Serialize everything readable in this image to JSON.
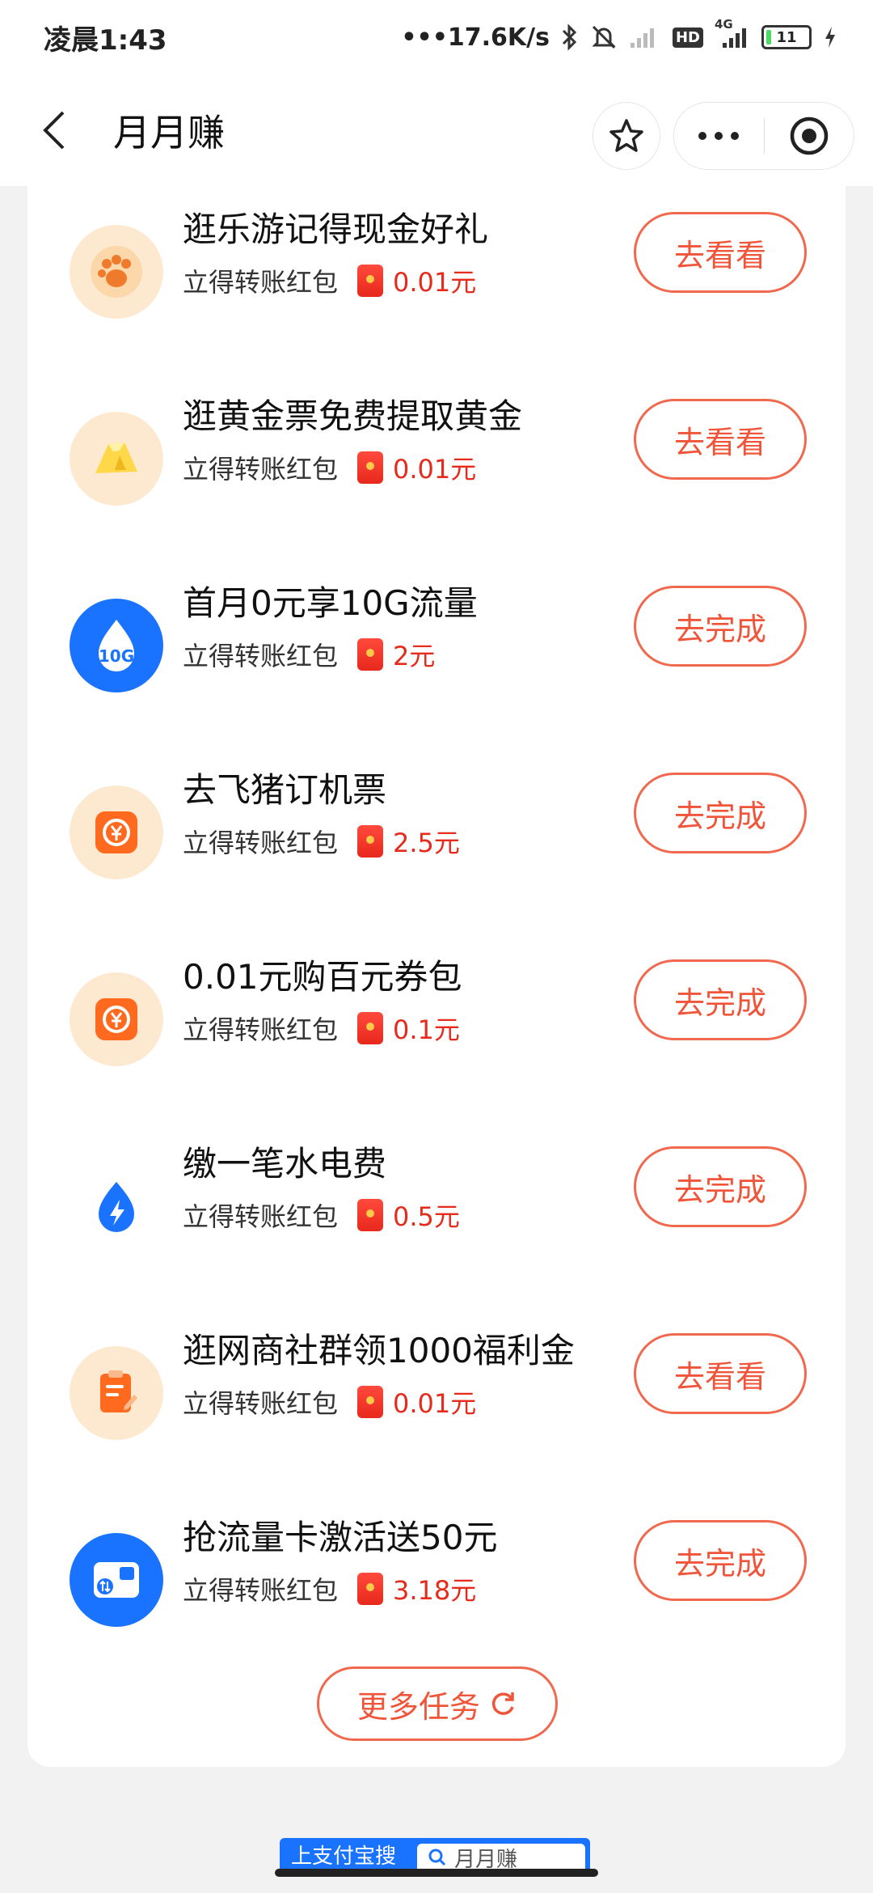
{
  "status_bar": {
    "time": "凌晨1:43",
    "network_speed": "17.6K/s",
    "hd_label": "HD",
    "network_type": "4G",
    "battery_level": "11",
    "battery_fraction": 0.11
  },
  "nav": {
    "title": "月月赚"
  },
  "tasks": [
    {
      "title": "逛乐游记得现金好礼",
      "subtitle": "立得转账红包",
      "amount": "0.01元",
      "action": "去看看",
      "icon": "paw-icon",
      "icon_bg": "#fde9d0"
    },
    {
      "title": "逛黄金票免费提取黄金",
      "subtitle": "立得转账红包",
      "amount": "0.01元",
      "action": "去看看",
      "icon": "gold-bar-icon",
      "icon_bg": "#fde9d0"
    },
    {
      "title": "首月0元享10G流量",
      "subtitle": "立得转账红包",
      "amount": "2元",
      "action": "去完成",
      "icon": "data-10g-icon",
      "icon_bg": "#1a73ff",
      "icon_text": "10G"
    },
    {
      "title": "去飞猪订机票",
      "subtitle": "立得转账红包",
      "amount": "2.5元",
      "action": "去完成",
      "icon": "yuan-bag-icon",
      "icon_bg": "#fde9d0"
    },
    {
      "title": "0.01元购百元券包",
      "subtitle": "立得转账红包",
      "amount": "0.1元",
      "action": "去完成",
      "icon": "yuan-bag-icon",
      "icon_bg": "#fde9d0"
    },
    {
      "title": "缴一笔水电费",
      "subtitle": "立得转账红包",
      "amount": "0.5元",
      "action": "去完成",
      "icon": "lightning-drop-icon",
      "icon_bg": "#ffffff"
    },
    {
      "title": "逛网商社群领1000福利金",
      "subtitle": "立得转账红包",
      "amount": "0.01元",
      "action": "去看看",
      "icon": "clipboard-icon",
      "icon_bg": "#fde9d0"
    },
    {
      "title": "抢流量卡激活送50元",
      "subtitle": "立得转账红包",
      "amount": "3.18元",
      "action": "去完成",
      "icon": "sim-card-icon",
      "icon_bg": "#1a73ff"
    }
  ],
  "more_tasks_label": "更多任务",
  "bottom_peek": {
    "left_text": "上支付宝搜",
    "right_text": "月月赚"
  },
  "colors": {
    "accent": "#f0553a",
    "amount_red": "#e62b1c",
    "blue": "#1a73ff"
  }
}
